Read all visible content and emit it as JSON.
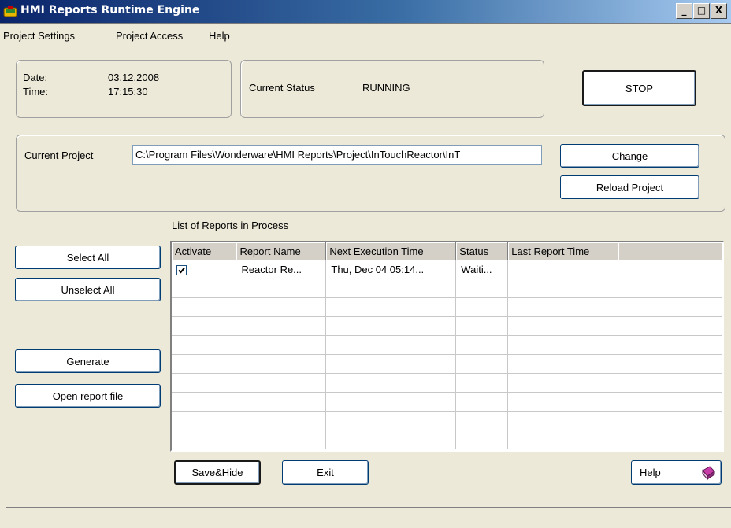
{
  "window": {
    "title": "HMI Reports Runtime Engine",
    "controls": {
      "minimize": "_",
      "maximize": "□",
      "close": "X"
    }
  },
  "menu": [
    "Project Settings",
    "Project Access",
    "Help"
  ],
  "datetime": {
    "date_label": "Date:",
    "date_value": "03.12.2008",
    "time_label": "Time:",
    "time_value": "17:15:30"
  },
  "status": {
    "label": "Current Status",
    "value": "RUNNING"
  },
  "stop_label": "STOP",
  "project": {
    "label": "Current Project",
    "path": "C:\\Program Files\\Wonderware\\HMI Reports\\Project\\InTouchReactor\\InT",
    "change_label": "Change",
    "reload_label": "Reload Project"
  },
  "left_buttons": {
    "select_all": "Select All",
    "unselect_all": "Unselect All",
    "generate": "Generate",
    "open_report": "Open report file"
  },
  "reports": {
    "title": "List of Reports in Process",
    "columns": [
      "Activate",
      "Report Name",
      "Next Execution Time",
      "Status",
      "Last Report Time"
    ],
    "rows": [
      {
        "activate": true,
        "name": "Reactor Re...",
        "next": "Thu, Dec 04 05:14...",
        "status": "Waiti...",
        "last": ""
      }
    ]
  },
  "bottom_buttons": {
    "save_hide": "Save&Hide",
    "exit": "Exit",
    "help": "Help"
  },
  "icons": {
    "app": "app-hmi-icon",
    "help": "help-book-icon",
    "check": "checkmark-icon"
  },
  "colors": {
    "titlebar_start": "#0a246a",
    "titlebar_end": "#a6caf0",
    "window_bg": "#ece9d8"
  }
}
